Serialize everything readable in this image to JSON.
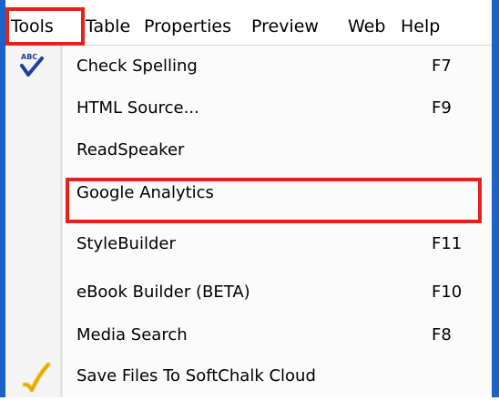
{
  "menubar": {
    "items": [
      {
        "label": "Tools",
        "highlighted": true
      },
      {
        "label": "Table"
      },
      {
        "label": "Properties"
      },
      {
        "label": "Preview"
      },
      {
        "label": "Web"
      },
      {
        "label": "Help"
      }
    ]
  },
  "tools_menu": {
    "items": [
      {
        "label": "Check Spelling",
        "shortcut": "F7",
        "icon": "spellcheck-icon"
      },
      {
        "label": "HTML Source...",
        "shortcut": "F9"
      },
      {
        "label": "ReadSpeaker",
        "shortcut": ""
      },
      {
        "label": "Google Analytics",
        "shortcut": "",
        "highlighted": true
      },
      {
        "label": "StyleBuilder",
        "shortcut": "F11"
      },
      {
        "label": "eBook Builder (BETA)",
        "shortcut": "F10"
      },
      {
        "label": "Media Search",
        "shortcut": "F8"
      },
      {
        "label": "Save Files To SoftChalk Cloud",
        "shortcut": "",
        "icon": "checkmark-save-icon"
      }
    ]
  },
  "icons": {
    "spellcheck_text": "ABC"
  },
  "colors": {
    "highlight_border": "#e2231a",
    "frame": "#1b62c8",
    "spellcheck_check": "#1c3fa0",
    "save_check": "#f2c21b"
  }
}
